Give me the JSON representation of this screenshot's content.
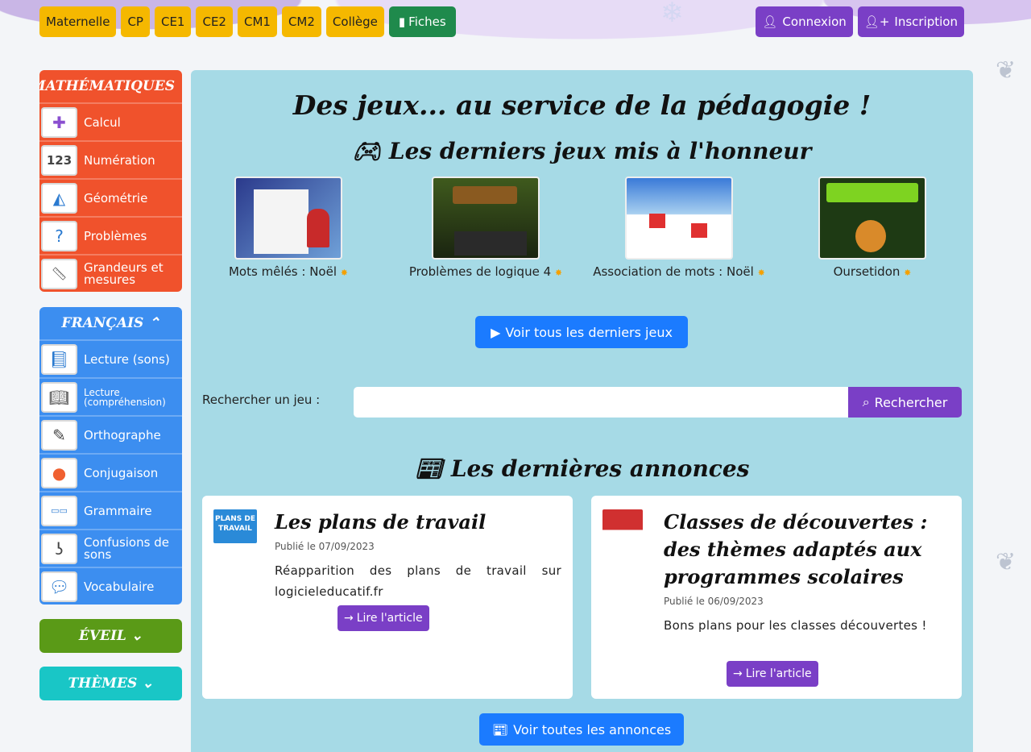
{
  "top_nav": {
    "levels": [
      "Maternelle",
      "CP",
      "CE1",
      "CE2",
      "CM1",
      "CM2",
      "Collège"
    ],
    "fiches": "Fiches",
    "login": "Connexion",
    "signup": "Inscription"
  },
  "sidebar": {
    "math": {
      "title": "MATHÉMATIQUES",
      "items": [
        "Calcul",
        "Numération",
        "Géométrie",
        "Problèmes",
        "Grandeurs et mesures"
      ]
    },
    "francais": {
      "title": "FRANÇAIS",
      "items": [
        "Lecture (sons)",
        "Lecture (compréhension)",
        "Orthographe",
        "Conjugaison",
        "Grammaire",
        "Confusions de sons",
        "Vocabulaire"
      ]
    },
    "eveil": "ÉVEIL",
    "themes": "THÈMES"
  },
  "main": {
    "title": "Des jeux... au service de la pédagogie !",
    "games_heading": "Les derniers jeux mis à l'honneur",
    "games": [
      {
        "label": "Mots mêlés : Noël"
      },
      {
        "label": "Problèmes de logique 4"
      },
      {
        "label": "Association de mots : Noël"
      },
      {
        "label": "Oursetidon"
      }
    ],
    "all_games_button": "Voir tous les derniers jeux",
    "search": {
      "label": "Rechercher un jeu :",
      "placeholder": "",
      "button": "Rechercher"
    },
    "news_heading": "Les dernières annonces",
    "news": [
      {
        "title": "Les plans de travail",
        "date": "Publié le 07/09/2023",
        "text": "Réapparition des plans de travail sur logicieleducatif.fr",
        "button": "Lire l'article",
        "thumb_text": "PLANS DE TRAVAIL"
      },
      {
        "title": "Classes de découvertes : des thèmes adaptés aux programmes scolaires",
        "date": "Publié le 06/09/2023",
        "text": "Bons plans pour les classes découvertes !",
        "button": "Lire l'article"
      }
    ],
    "all_news_button": "Voir toutes les annonces"
  },
  "colors": {
    "math": "#f0522c",
    "francais": "#3c8ef0",
    "eveil": "#5a9a17",
    "themes": "#19c6c6",
    "purple": "#7a3fc6",
    "blue": "#1b7bff",
    "panel": "#a6dae6",
    "yellow": "#f5b800"
  }
}
